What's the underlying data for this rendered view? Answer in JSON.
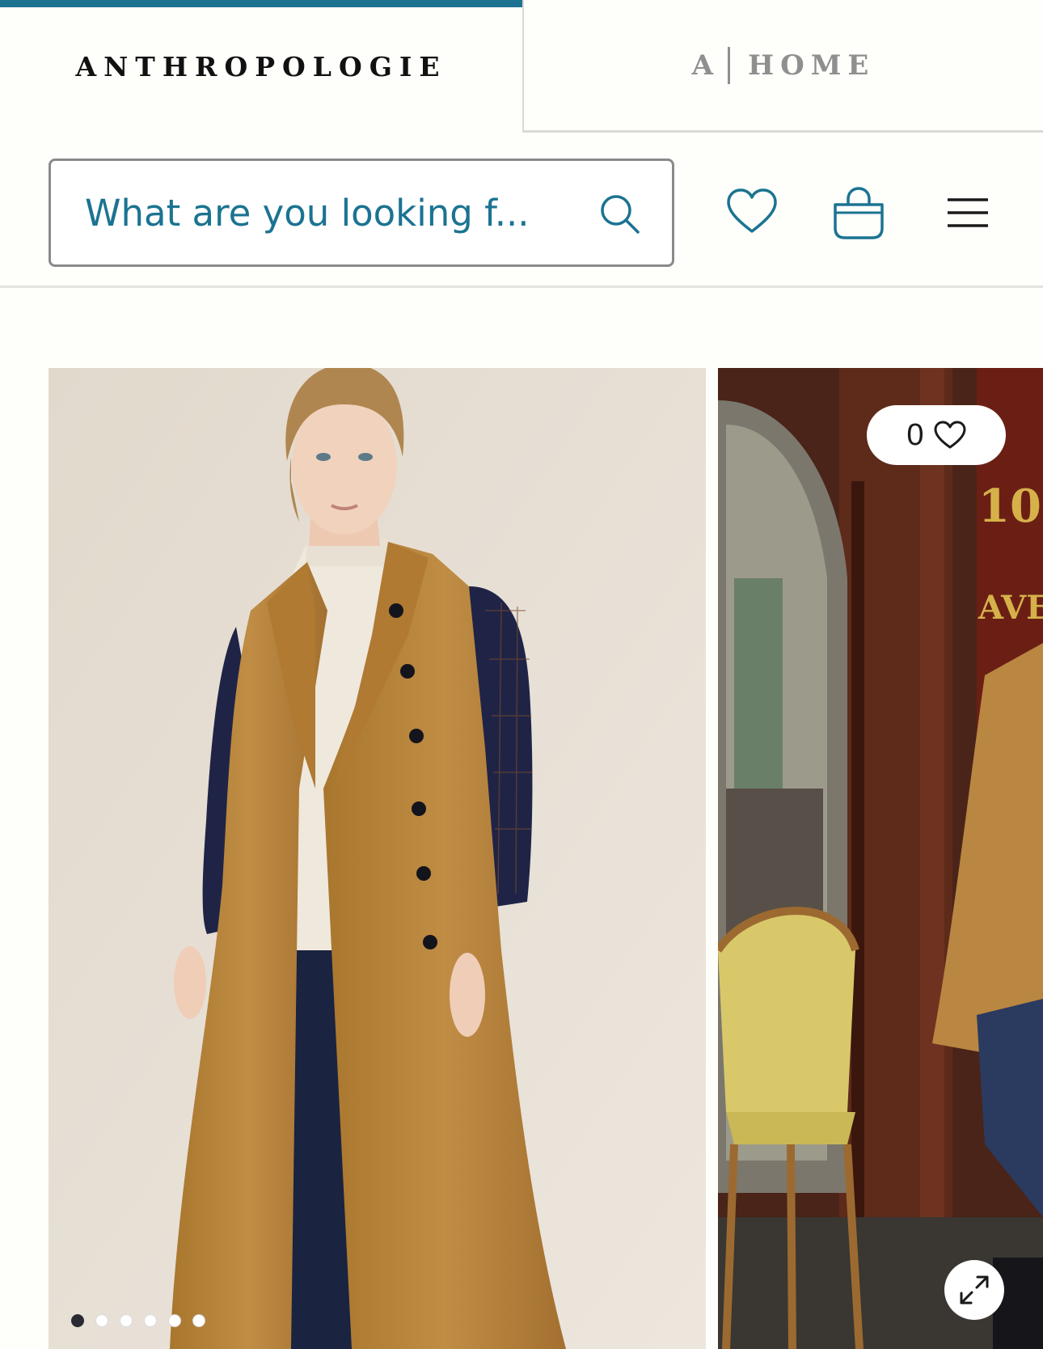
{
  "brands": {
    "primary": "ANTHROPOLOGIE",
    "secondary_letter": "A",
    "secondary_label": "HOME"
  },
  "search": {
    "placeholder": "What are you looking f..."
  },
  "header_icons": [
    "wishlist-heart-icon",
    "shopping-bag-icon",
    "menu-hamburger-icon"
  ],
  "product": {
    "favorites_count": "0",
    "carousel_dots": 6,
    "active_dot": 0
  },
  "colors": {
    "accent": "#1b7391",
    "background": "#fefefb",
    "inactive_tab_text": "#8f8f8f"
  }
}
